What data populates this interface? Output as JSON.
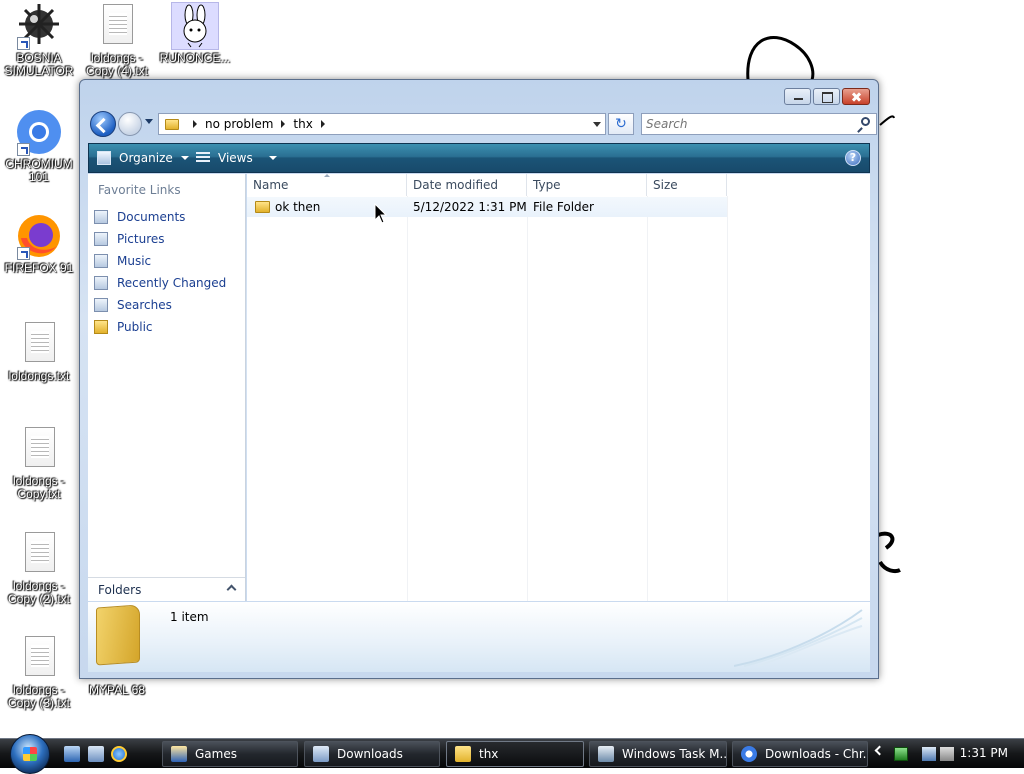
{
  "desktop": {
    "icons": [
      {
        "label": "BOSNIA SIMULATOR"
      },
      {
        "label": "loldongs - Copy (4).txt"
      },
      {
        "label": "RUNONCE..."
      },
      {
        "label": "CHROMIUM 101"
      },
      {
        "label": "FIREFOX 91"
      },
      {
        "label": "loldongs.txt"
      },
      {
        "label": "loldongs - Copy.txt"
      },
      {
        "label": "loldongs - Copy (2).txt"
      },
      {
        "label": "loldongs - Copy (3).txt"
      },
      {
        "label": "MYPAL 68"
      }
    ]
  },
  "window": {
    "address": {
      "crumbs": [
        "no problem",
        "thx"
      ]
    },
    "search": {
      "placeholder": "Search"
    },
    "toolbar": {
      "organize": "Organize",
      "views": "Views",
      "help": "?"
    },
    "navigation": {
      "title": "Favorite Links",
      "links": [
        "Documents",
        "Pictures",
        "Music",
        "Recently Changed",
        "Searches",
        "Public"
      ],
      "folders": "Folders"
    },
    "columns": [
      "Name",
      "Date modified",
      "Type",
      "Size"
    ],
    "files": [
      {
        "name": "ok then",
        "date": "5/12/2022 1:31 PM",
        "type": "File Folder",
        "size": ""
      }
    ],
    "details": {
      "count": "1 item"
    }
  },
  "taskbar": {
    "buttons": [
      "Games",
      "Downloads",
      "thx",
      "Windows Task M...",
      "Downloads - Chr..."
    ],
    "active": "thx",
    "clock": "1:31 PM"
  },
  "colors": {
    "accent": "#2a6f92",
    "link": "#1b3f91",
    "taskbar": "#151719"
  }
}
